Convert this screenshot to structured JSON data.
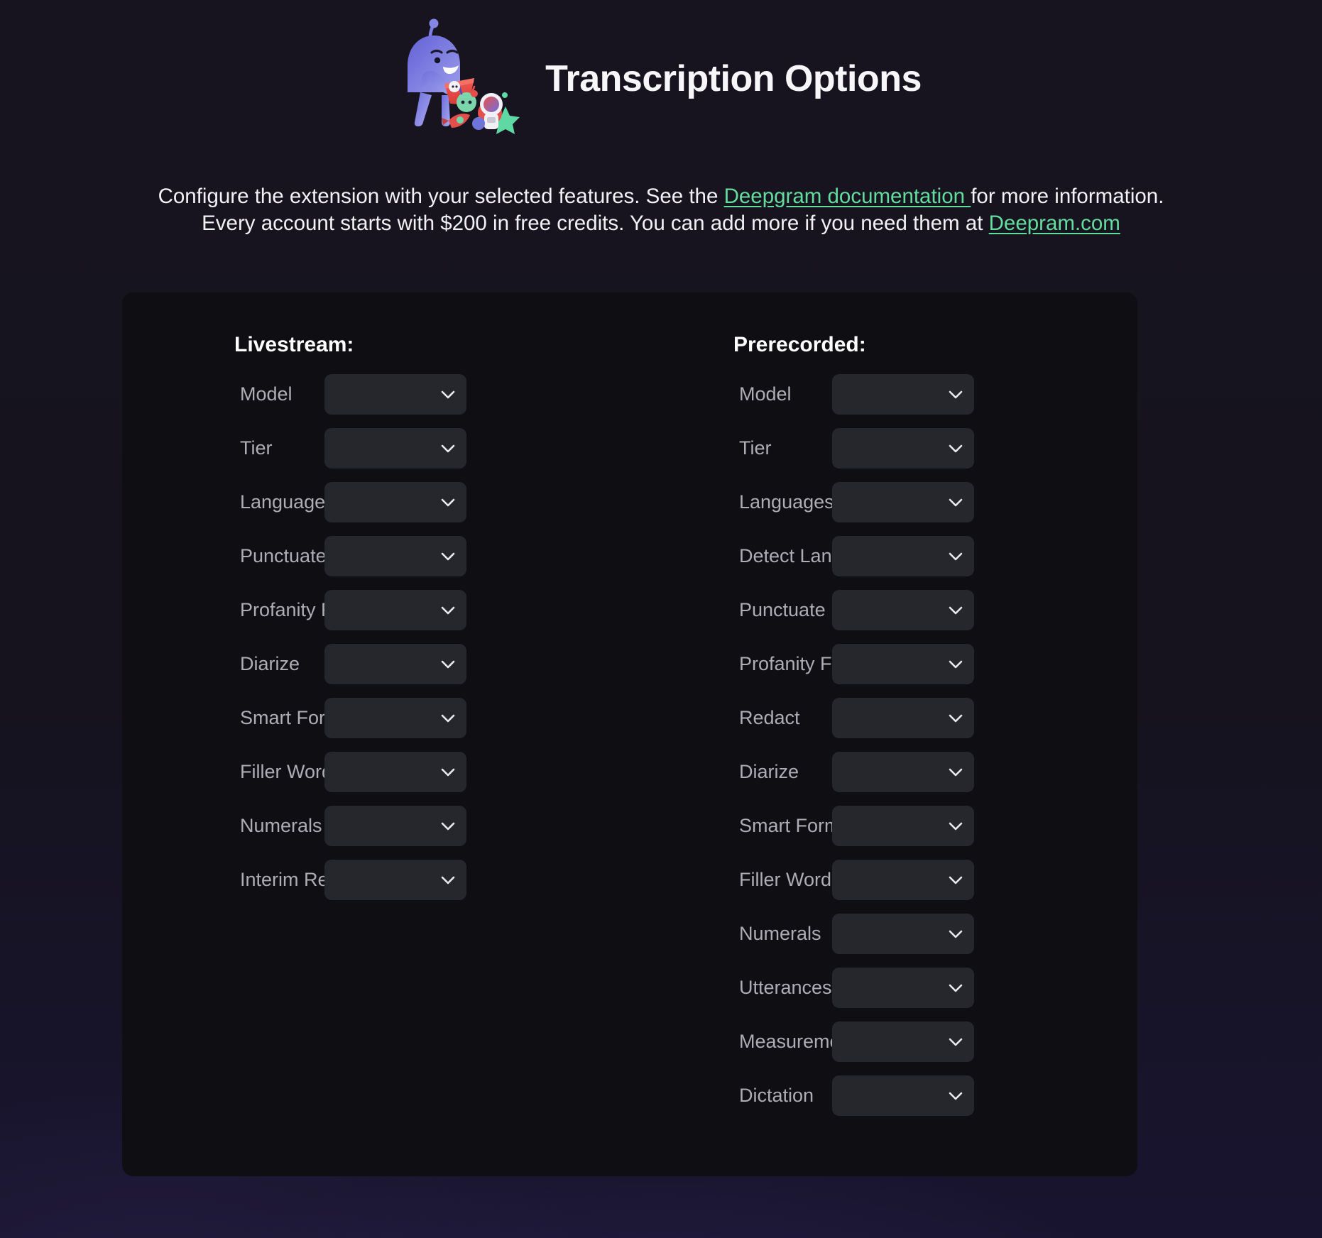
{
  "header": {
    "title": "Transcription Options",
    "mascot_alt": "deepgram-robot-mascot"
  },
  "description": {
    "line1_before_link": "Configure the extension with your selected features. See the ",
    "link1_text": "Deepgram documentation ",
    "line1_after_link": "for more information.",
    "line2_before_link": "Every account starts with $200 in free credits. You can add more if you need them at ",
    "link2_text": "Deepram.com"
  },
  "colors": {
    "accent_link": "#63dc9e",
    "panel_bg": "#0e0e13",
    "select_bg": "#26262d",
    "page_bg": "#17141f",
    "label_text": "#adadb3",
    "mascot_body": "#6f6fdf"
  },
  "panel": {
    "livestream": {
      "title": "Livestream:",
      "options": [
        {
          "label": "Model",
          "value": ""
        },
        {
          "label": "Tier",
          "value": ""
        },
        {
          "label": "Languages",
          "value": ""
        },
        {
          "label": "Punctuate",
          "value": ""
        },
        {
          "label": "Profanity Filter",
          "value": ""
        },
        {
          "label": "Diarize",
          "value": ""
        },
        {
          "label": "Smart Format",
          "value": ""
        },
        {
          "label": "Filler Words",
          "value": ""
        },
        {
          "label": "Numerals",
          "value": ""
        },
        {
          "label": "Interim Results",
          "value": ""
        }
      ]
    },
    "prerecorded": {
      "title": "Prerecorded:",
      "options": [
        {
          "label": "Model",
          "value": ""
        },
        {
          "label": "Tier",
          "value": ""
        },
        {
          "label": "Languages",
          "value": ""
        },
        {
          "label": "Detect Language",
          "value": ""
        },
        {
          "label": "Punctuate",
          "value": ""
        },
        {
          "label": "Profanity Filter",
          "value": ""
        },
        {
          "label": "Redact",
          "value": ""
        },
        {
          "label": "Diarize",
          "value": ""
        },
        {
          "label": "Smart Format",
          "value": ""
        },
        {
          "label": "Filler Words",
          "value": ""
        },
        {
          "label": "Numerals",
          "value": ""
        },
        {
          "label": "Utterances",
          "value": ""
        },
        {
          "label": "Measurements",
          "value": ""
        },
        {
          "label": "Dictation",
          "value": ""
        }
      ]
    }
  }
}
